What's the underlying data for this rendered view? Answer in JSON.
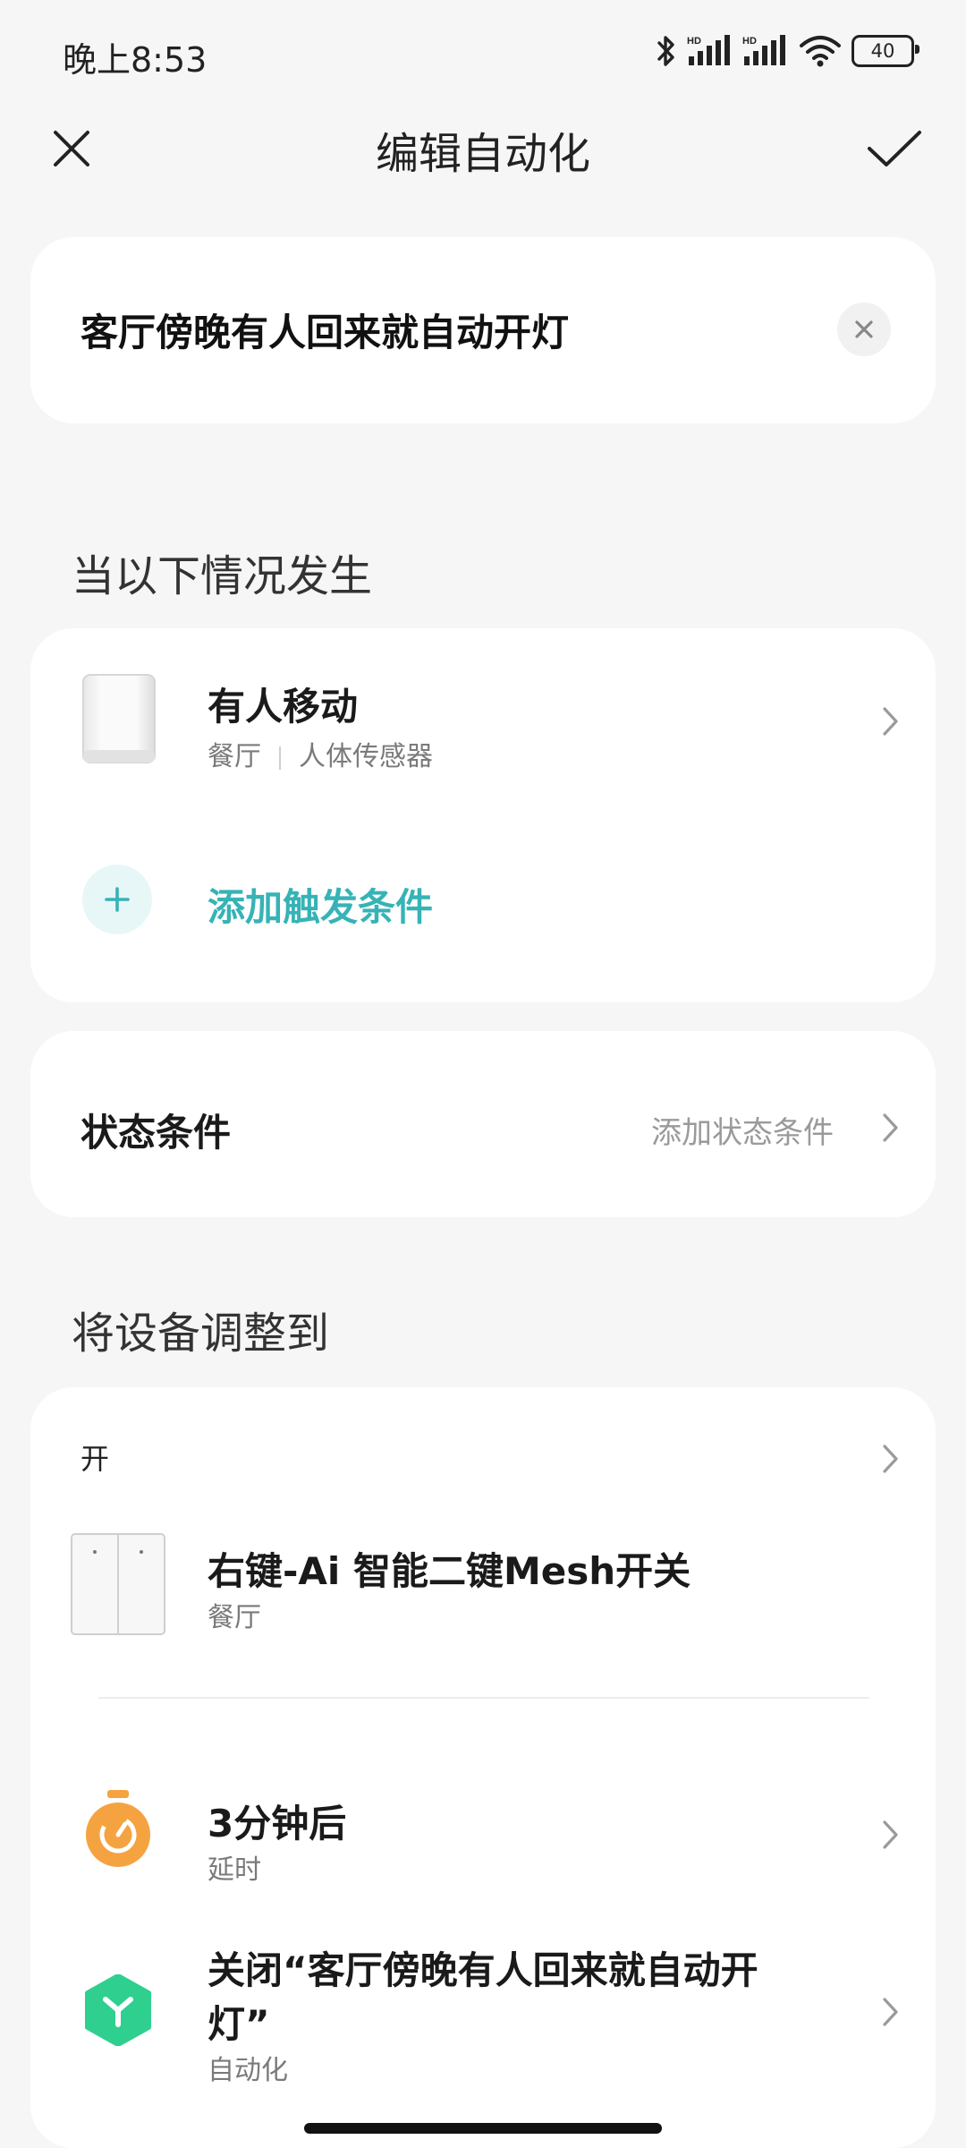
{
  "status_bar": {
    "time": "晚上8:53",
    "battery": "40",
    "icons": [
      "bluetooth-icon",
      "signal-hd-icon",
      "signal-hd-icon",
      "wifi-icon",
      "battery-icon"
    ]
  },
  "header": {
    "title": "编辑自动化",
    "close_icon": "close-icon",
    "confirm_icon": "check-icon"
  },
  "automation_name": {
    "value": "客厅傍晚有人回来就自动开灯",
    "clear_icon": "clear-icon"
  },
  "trigger_section": {
    "title": "当以下情况发生",
    "items": [
      {
        "title": "有人移动",
        "room": "餐厅",
        "device": "人体传感器",
        "icon": "motion-sensor-icon"
      }
    ],
    "add_label": "添加触发条件"
  },
  "state_condition": {
    "label": "状态条件",
    "action_label": "添加状态条件"
  },
  "action_section": {
    "title": "将设备调整到",
    "items": [
      {
        "state": "开",
        "title": "右键-Ai 智能二键Mesh开关",
        "subtitle": "餐厅",
        "icon": "switch-icon"
      },
      {
        "title": "3分钟后",
        "subtitle": "延时",
        "icon": "timer-icon"
      },
      {
        "title": "关闭“客厅傍晚有人回来就自动开灯”",
        "subtitle": "自动化",
        "icon": "automation-icon"
      }
    ]
  },
  "colors": {
    "accent": "#36b3b6",
    "timer_orange": "#f5a340",
    "automation_green": "#2fcf8f",
    "background": "#f6f6f6"
  }
}
